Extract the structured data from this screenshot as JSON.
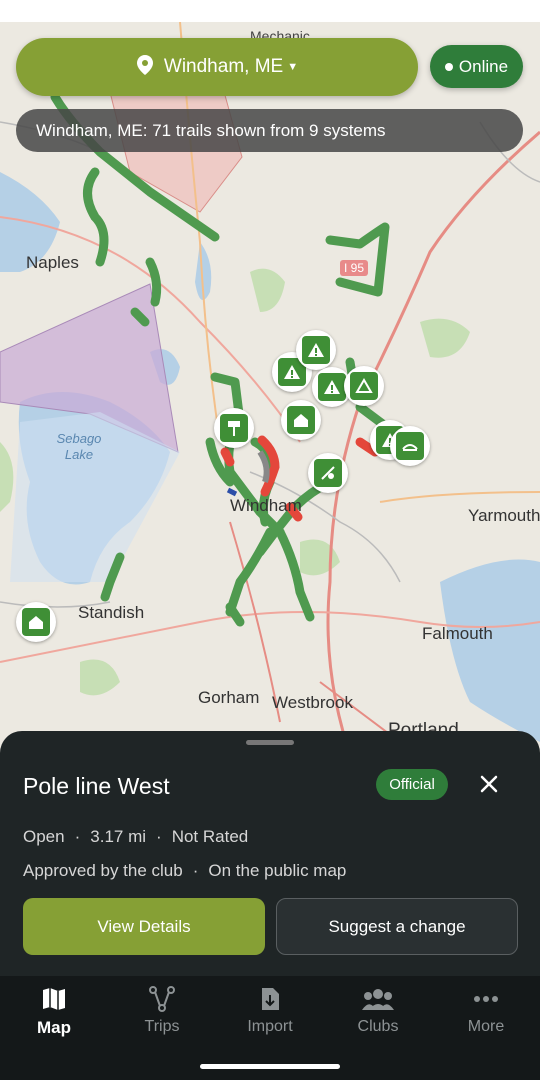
{
  "header": {
    "location": "Windham, ME",
    "online_label": "Online",
    "banner": "Windham, ME: 71 trails shown from 9 systems"
  },
  "map_labels": {
    "naples": "Naples",
    "sebago": "Sebago\nLake",
    "windham": "Windham",
    "standish": "Standish",
    "gorham": "Gorham",
    "westbrook": "Westbrook",
    "portland": "Portland",
    "falmouth": "Falmouth",
    "yarmouth": "Yarmouth",
    "highway": "I 95",
    "mechanic": "Mechanic"
  },
  "sheet": {
    "trail_name": "Pole line West",
    "badge": "Official",
    "status": "Open",
    "distance": "3.17 mi",
    "rating": "Not Rated",
    "approval": "Approved by the club",
    "visibility": "On the public map",
    "view_details": "View Details",
    "suggest_change": "Suggest a change"
  },
  "tabs": [
    {
      "label": "Map",
      "icon": "map-icon",
      "active": true
    },
    {
      "label": "Trips",
      "icon": "trips-icon",
      "active": false
    },
    {
      "label": "Import",
      "icon": "import-icon",
      "active": false
    },
    {
      "label": "Clubs",
      "icon": "clubs-icon",
      "active": false
    },
    {
      "label": "More",
      "icon": "more-icon",
      "active": false
    }
  ],
  "colors": {
    "accent_olive": "#86a035",
    "trail_green": "#4f9a4f",
    "trail_red": "#e4473b",
    "badge_green": "#2f7d3a",
    "sheet_bg": "#1f2526"
  }
}
